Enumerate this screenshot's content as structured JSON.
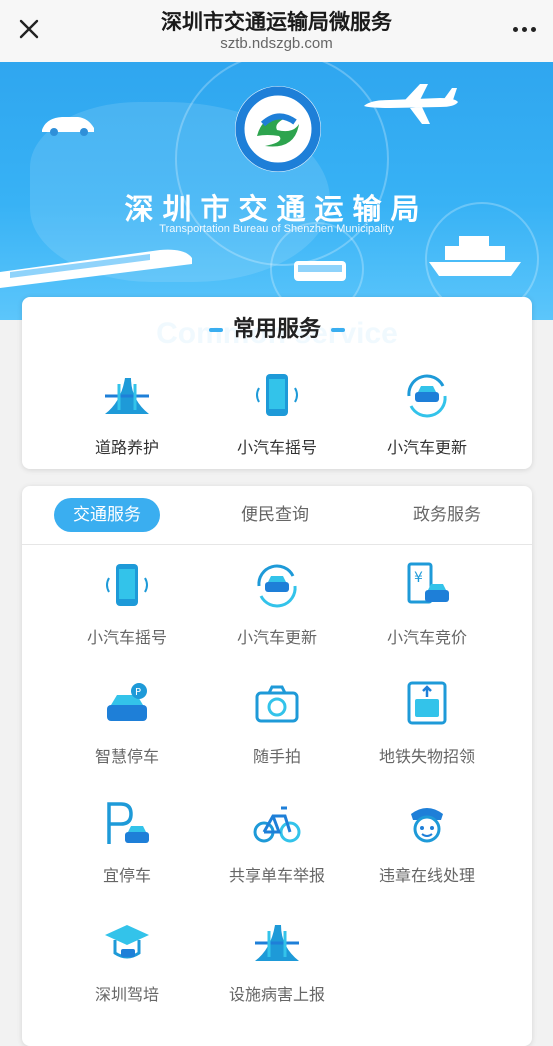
{
  "header": {
    "title": "深圳市交通运输局微服务",
    "url": "sztb.ndszgb.com"
  },
  "banner": {
    "title_cn": "深圳市交通运输局",
    "title_en": "Transportation Bureau of Shenzhen Municipality"
  },
  "common": {
    "title": "常用服务",
    "bg_text": "Common service",
    "items": [
      {
        "label": "道路养护",
        "icon": "road-icon"
      },
      {
        "label": "小汽车摇号",
        "icon": "phone-icon"
      },
      {
        "label": "小汽车更新",
        "icon": "car-refresh-icon"
      }
    ]
  },
  "tabs": [
    {
      "label": "交通服务",
      "active": true
    },
    {
      "label": "便民查询",
      "active": false
    },
    {
      "label": "政务服务",
      "active": false
    }
  ],
  "services": [
    {
      "label": "小汽车摇号",
      "icon": "phone-icon"
    },
    {
      "label": "小汽车更新",
      "icon": "car-refresh-icon"
    },
    {
      "label": "小汽车竞价",
      "icon": "car-bid-icon"
    },
    {
      "label": "智慧停车",
      "icon": "smart-parking-icon"
    },
    {
      "label": "随手拍",
      "icon": "camera-icon"
    },
    {
      "label": "地铁失物招领",
      "icon": "subway-icon"
    },
    {
      "label": "宜停车",
      "icon": "parking-icon"
    },
    {
      "label": "共享单车举报",
      "icon": "bicycle-icon"
    },
    {
      "label": "违章在线处理",
      "icon": "police-icon"
    },
    {
      "label": "深圳驾培",
      "icon": "driving-school-icon"
    },
    {
      "label": "设施病害上报",
      "icon": "road-icon"
    }
  ],
  "colors": {
    "accent": "#3aaef0",
    "icon_dark": "#1e7fd8",
    "icon_light": "#33c3ea"
  }
}
